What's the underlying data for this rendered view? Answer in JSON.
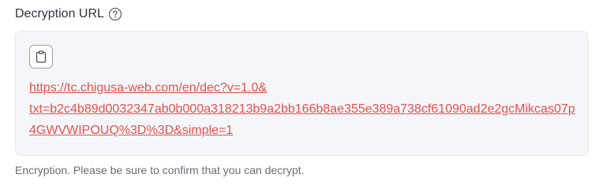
{
  "decryption": {
    "label": "Decryption URL",
    "help_icon": "question-circle-icon",
    "copy_icon": "clipboard-icon",
    "url_line_1": "https://tc.chigusa-web.com/en/dec?v=1.0&",
    "url_line_2": "txt=b2c4b89d0032347ab0b000a318213b9a2bb166b8ae355e389a738cf61090ad2e2gcMikcas07p",
    "url_line_3": "4GWVWIPOUQ%3D%3D&simple=1",
    "caption": "Encryption. Please be sure to confirm that you can decrypt."
  },
  "colors": {
    "link": "#e8504a",
    "box_background": "#f5f6f9",
    "label_text": "#31333f",
    "caption_text": "#6a6e78"
  }
}
